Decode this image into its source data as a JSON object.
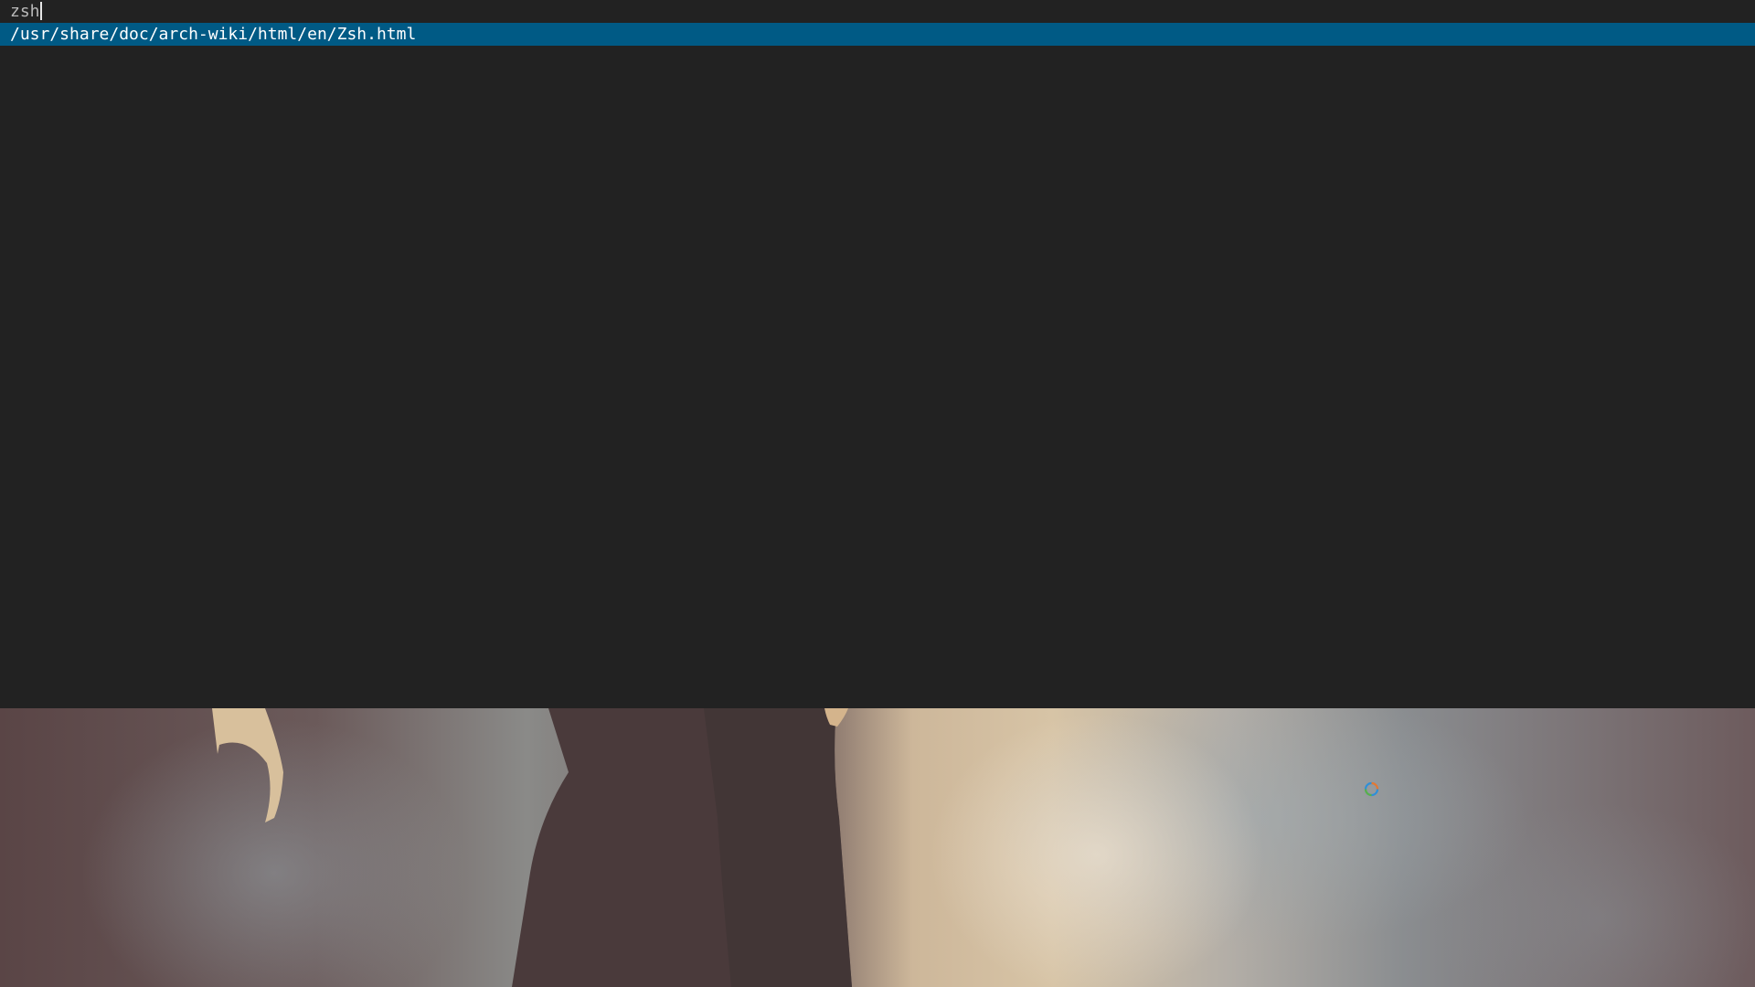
{
  "launcher": {
    "query": "zsh",
    "results": [
      "/usr/share/doc/arch-wiki/html/en/Zsh.html"
    ],
    "selected_index": 0,
    "colors": {
      "background": "#222222",
      "selected_background": "#005a85",
      "text": "#e8e8e8"
    }
  },
  "wallpaper": {
    "description_icon": "photo-wallpaper"
  },
  "cursor": {
    "icon": "busy-cursor-icon"
  }
}
